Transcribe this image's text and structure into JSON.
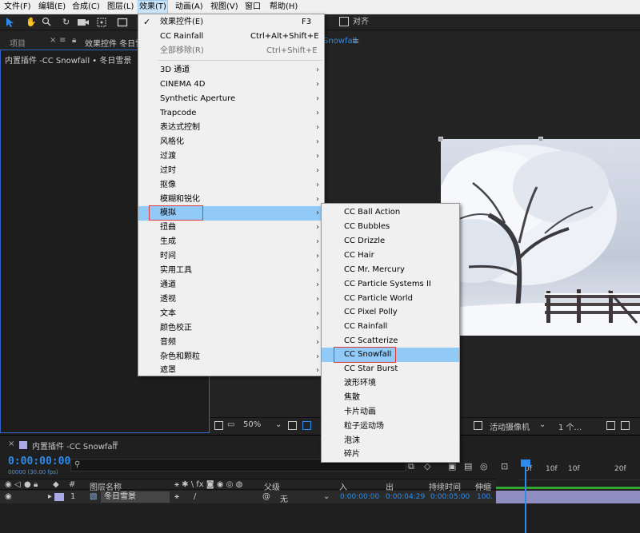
{
  "menubar": {
    "items": [
      "文件(F)",
      "编辑(E)",
      "合成(C)",
      "图层(L)",
      "效果(T)",
      "动画(A)",
      "视图(V)",
      "窗口",
      "帮助(H)"
    ]
  },
  "toolbar": {
    "align_label": "对齐"
  },
  "left_panel": {
    "tab_project": "项目",
    "tab_effects": "效果控件 冬日雪",
    "subtitle": "内置插件 -CC Snowfall • 冬日雪景"
  },
  "viewer": {
    "tab_tail": "Snowfall",
    "zoom": "50%",
    "camera": "活动摄像机",
    "views": "1 个..."
  },
  "effect_menu": {
    "items": [
      {
        "label": "效果控件(E)",
        "shortcut": "F3",
        "checked": true
      },
      {
        "label": "CC Rainfall",
        "shortcut": "Ctrl+Alt+Shift+E"
      },
      {
        "label": "全部移除(R)",
        "shortcut": "Ctrl+Shift+E",
        "disabled": true
      },
      {
        "label": "3D 通道",
        "submenu": true
      },
      {
        "label": "CINEMA 4D",
        "submenu": true
      },
      {
        "label": "Synthetic Aperture",
        "submenu": true
      },
      {
        "label": "Trapcode",
        "submenu": true
      },
      {
        "label": "表达式控制",
        "submenu": true
      },
      {
        "label": "风格化",
        "submenu": true
      },
      {
        "label": "过渡",
        "submenu": true
      },
      {
        "label": "过时",
        "submenu": true
      },
      {
        "label": "抠像",
        "submenu": true
      },
      {
        "label": "模糊和锐化",
        "submenu": true
      },
      {
        "label": "模拟",
        "submenu": true,
        "highlighted": true
      },
      {
        "label": "扭曲",
        "submenu": true
      },
      {
        "label": "生成",
        "submenu": true
      },
      {
        "label": "时间",
        "submenu": true
      },
      {
        "label": "实用工具",
        "submenu": true
      },
      {
        "label": "通道",
        "submenu": true
      },
      {
        "label": "透视",
        "submenu": true
      },
      {
        "label": "文本",
        "submenu": true
      },
      {
        "label": "颜色校正",
        "submenu": true
      },
      {
        "label": "音频",
        "submenu": true
      },
      {
        "label": "杂色和颗粒",
        "submenu": true
      },
      {
        "label": "遮罩",
        "submenu": true
      }
    ]
  },
  "simulate_submenu": {
    "items": [
      "CC Ball Action",
      "CC Bubbles",
      "CC Drizzle",
      "CC Hair",
      "CC Mr. Mercury",
      "CC Particle Systems II",
      "CC Particle World",
      "CC Pixel Polly",
      "CC Rainfall",
      "CC Scatterize",
      "CC Snowfall",
      "CC Star Burst",
      "波形环境",
      "焦散",
      "卡片动画",
      "粒子运动场",
      "泡沫",
      "碎片"
    ],
    "highlighted_index": 10
  },
  "timeline": {
    "comp_tab": "内置插件 -CC Snowfall",
    "timecode": "0:00:00:00",
    "timecode_sub": "00000 (30.00 fps)",
    "columns": {
      "num": "#",
      "layer_name": "图层名称",
      "parent": "父级",
      "in": "入",
      "out": "出",
      "duration": "持续时间",
      "stretch": "伸缩"
    },
    "layer": {
      "index": "1",
      "name": "冬日雪景",
      "parent": "无",
      "in": "0:00:00:00",
      "out": "0:00:04:29",
      "duration": "0:00:05:00",
      "stretch": "100."
    },
    "ruler": [
      "0f",
      "10f",
      "10f",
      "20f"
    ]
  },
  "colors": {
    "accent": "#2d8ceb",
    "menu_highlight": "#91c9f7",
    "red_outline": "#e03a3a",
    "track": "#8e8ec2"
  }
}
